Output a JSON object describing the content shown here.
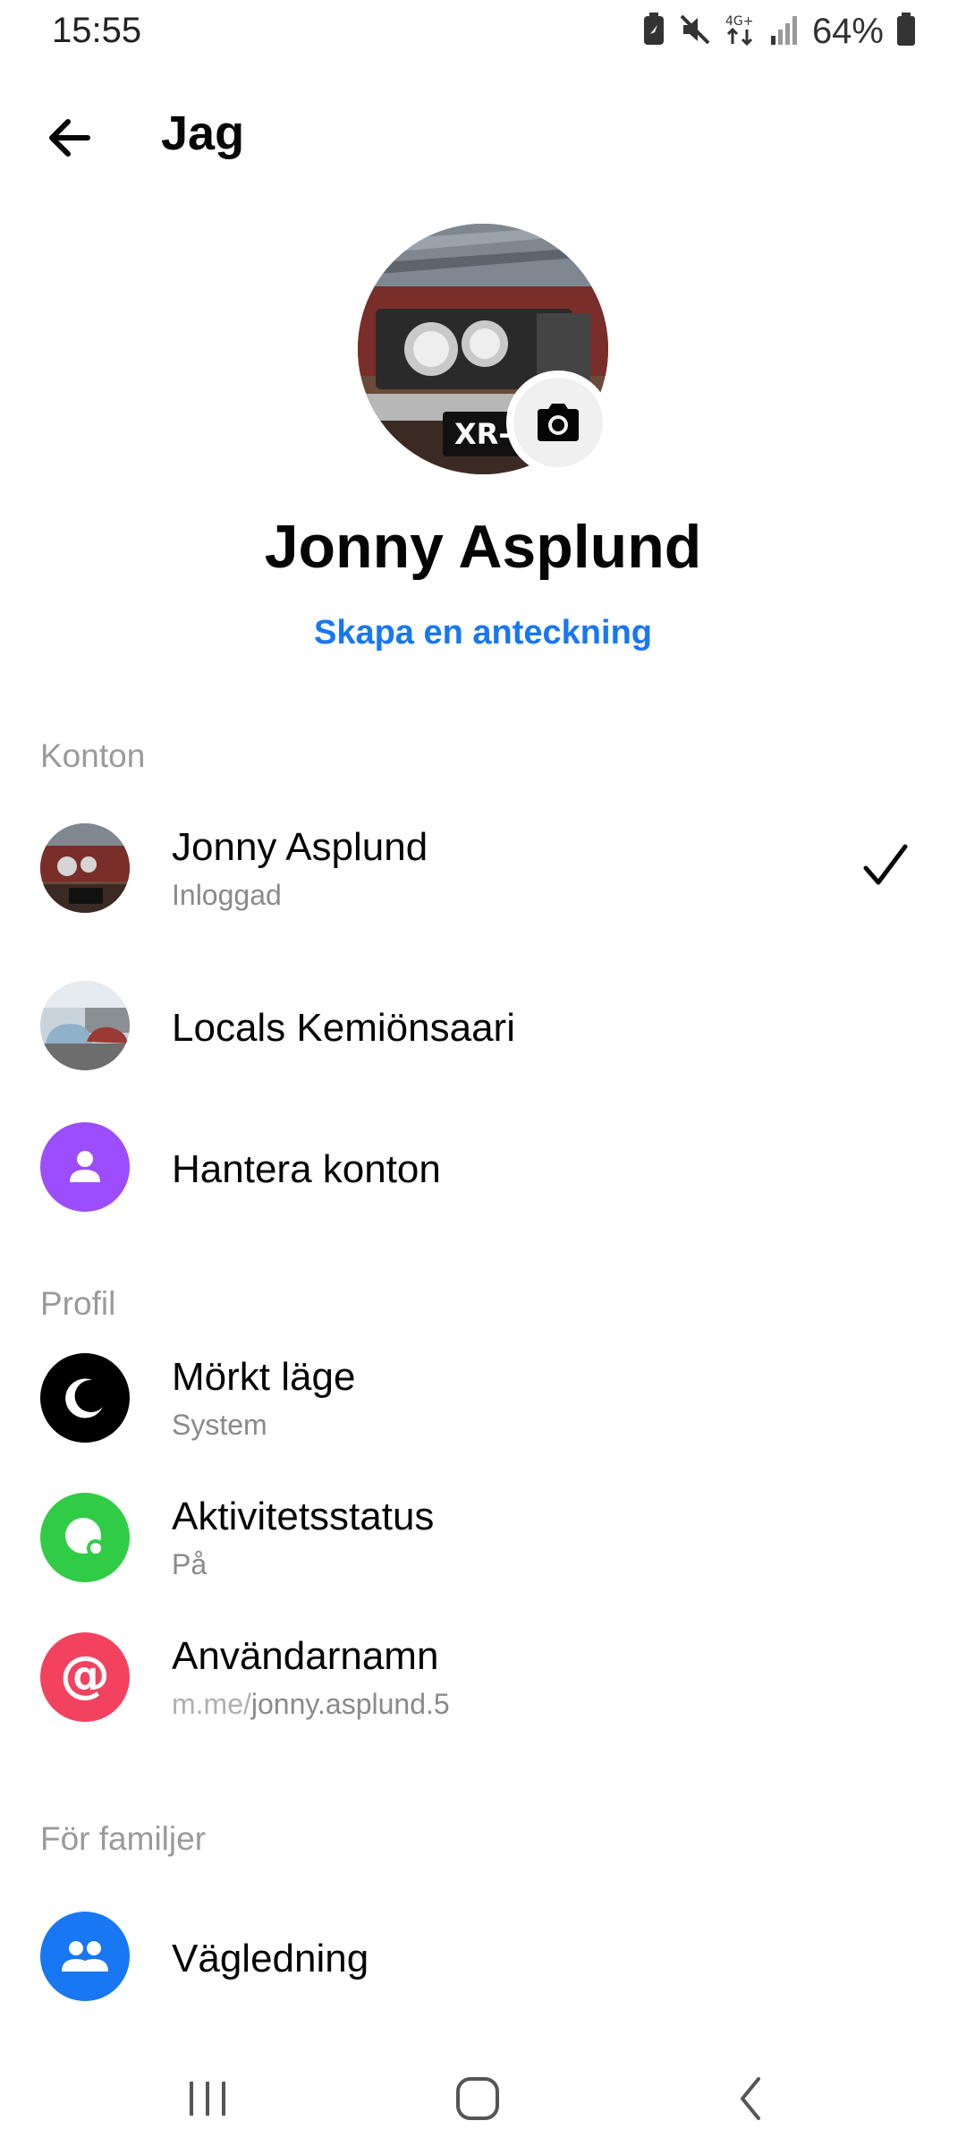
{
  "status_bar": {
    "time": "15:55",
    "battery_percent": "64%",
    "network": "4G+"
  },
  "header": {
    "title": "Jag",
    "back_icon": "arrow-left-icon"
  },
  "profile": {
    "name": "Jonny Asplund",
    "create_note_label": "Skapa en anteckning",
    "camera_icon": "camera-icon",
    "plate_text": "XR-7"
  },
  "sections": {
    "accounts": {
      "header": "Konton",
      "items": [
        {
          "title": "Jonny Asplund",
          "subtitle": "Inloggad",
          "selected": true
        },
        {
          "title": "Locals Kemiönsaari"
        },
        {
          "title": "Hantera konton",
          "icon": "person-icon",
          "color": "#9b4dff"
        }
      ]
    },
    "profile": {
      "header": "Profil",
      "items": [
        {
          "title": "Mörkt läge",
          "subtitle": "System",
          "icon": "moon-icon",
          "color": "#000000"
        },
        {
          "title": "Aktivitetsstatus",
          "subtitle": "På",
          "icon": "active-status-icon",
          "color": "#31cc46"
        },
        {
          "title": "Användarnamn",
          "subtitle_prefix": "m.me/",
          "subtitle": "jonny.asplund.5",
          "icon": "at-sign-icon",
          "color": "#f3425f"
        }
      ]
    },
    "families": {
      "header": "För familjer",
      "items": [
        {
          "title": "Vägledning",
          "icon": "people-icon",
          "color": "#1877f2"
        }
      ]
    }
  },
  "colors": {
    "accent": "#1877f2",
    "section_header": "#9a9a9a",
    "subtitle": "#8a8a8a"
  }
}
